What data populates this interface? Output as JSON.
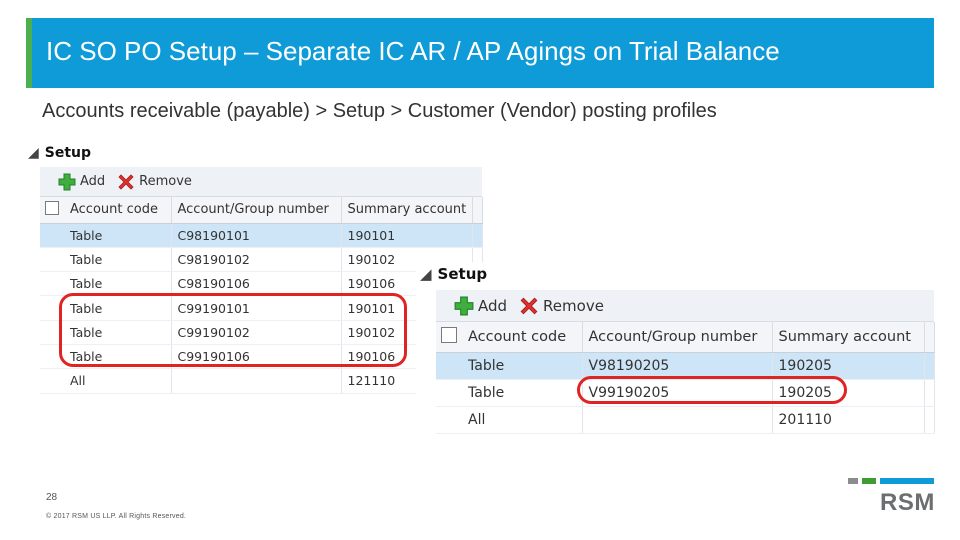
{
  "slide": {
    "title": "IC SO PO Setup – Separate IC AR / AP Agings on Trial Balance",
    "subtitle": "Accounts receivable (payable) > Setup > Customer (Vendor) posting profiles",
    "page_number": "28",
    "copyright": "© 2017 RSM US LLP. All Rights Reserved.",
    "logo_text": "RSM"
  },
  "colors": {
    "title_bar": "#0f9bd7",
    "title_accent": "#4caf50",
    "highlight_circle": "#e02424",
    "selected_row": "#cde5f7"
  },
  "customer_panel": {
    "section_label": "Setup",
    "toolbar": {
      "add_label": "Add",
      "remove_label": "Remove"
    },
    "columns": [
      "Account code",
      "Account/Group number",
      "Summary account"
    ],
    "rows": [
      {
        "account_code": "Table",
        "account_group": "C98190101",
        "summary": "190101",
        "selected": true
      },
      {
        "account_code": "Table",
        "account_group": "C98190102",
        "summary": "190102",
        "selected": false
      },
      {
        "account_code": "Table",
        "account_group": "C98190106",
        "summary": "190106",
        "selected": false
      },
      {
        "account_code": "Table",
        "account_group": "C99190101",
        "summary": "190101",
        "selected": false
      },
      {
        "account_code": "Table",
        "account_group": "C99190102",
        "summary": "190102",
        "selected": false
      },
      {
        "account_code": "Table",
        "account_group": "C99190106",
        "summary": "190106",
        "selected": false
      },
      {
        "account_code": "All",
        "account_group": "",
        "summary": "121110",
        "selected": false
      }
    ]
  },
  "vendor_panel": {
    "section_label": "Setup",
    "toolbar": {
      "add_label": "Add",
      "remove_label": "Remove"
    },
    "columns": [
      "Account code",
      "Account/Group number",
      "Summary account"
    ],
    "rows": [
      {
        "account_code": "Table",
        "account_group": "V98190205",
        "summary": "190205",
        "selected": true
      },
      {
        "account_code": "Table",
        "account_group": "V99190205",
        "summary": "190205",
        "selected": false
      },
      {
        "account_code": "All",
        "account_group": "",
        "summary": "201110",
        "selected": false
      }
    ]
  }
}
